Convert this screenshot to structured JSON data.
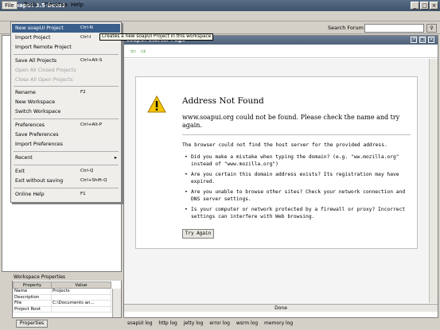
{
  "window": {
    "title": "soapUI 3.5-beta1"
  },
  "menubar": [
    {
      "label": "File"
    },
    {
      "label": "Tools"
    },
    {
      "label": "Desktop"
    },
    {
      "label": "Help"
    }
  ],
  "search": {
    "label": "Search Forum"
  },
  "file_menu": [
    {
      "label": "New soapUI Project",
      "shortcut": "Ctrl-N",
      "selected": true
    },
    {
      "label": "Import Project",
      "shortcut": "Ctrl-I"
    },
    {
      "label": "Import Remote Project",
      "shortcut": ""
    },
    {
      "sep": true
    },
    {
      "label": "Save All Projects",
      "shortcut": "Ctrl+Alt-S"
    },
    {
      "label": "Open All Closed Projects",
      "shortcut": "",
      "disabled": true
    },
    {
      "label": "Close All Open Projects",
      "shortcut": "",
      "disabled": true
    },
    {
      "sep": true
    },
    {
      "label": "Rename",
      "shortcut": "F2"
    },
    {
      "label": "New Workspace",
      "shortcut": ""
    },
    {
      "label": "Switch Workspace",
      "shortcut": ""
    },
    {
      "sep": true
    },
    {
      "label": "Preferences",
      "shortcut": "Ctrl+Alt-P"
    },
    {
      "label": "Save Preferences",
      "shortcut": ""
    },
    {
      "label": "Import Preferences",
      "shortcut": ""
    },
    {
      "sep": true
    },
    {
      "label": "Recent",
      "shortcut": "",
      "submenu": true
    },
    {
      "sep": true
    },
    {
      "label": "Exit",
      "shortcut": "Ctrl-Q"
    },
    {
      "label": "Exit without saving",
      "shortcut": "Ctrl+Shift-Q"
    },
    {
      "sep": true
    },
    {
      "label": "Online Help",
      "shortcut": "F1"
    }
  ],
  "tooltip": "Creates a new soapUI Project in this workspace",
  "starter": {
    "tab_title": "soapUI Starter Page"
  },
  "error_page": {
    "title": "Address Not Found",
    "message": "www.soapui.org could not be found. Please check the name and try again.",
    "description": "The browser could not find the host server for the provided address.",
    "bullets": [
      "Did you make a mistake when typing the domain? (e.g. \"ww.mozilla.org\" instead of \"www.mozilla.org\")",
      "Are you certain this domain address exists? Its registration may have expired.",
      "Are you unable to browse other sites? Check your network connection and DNS server settings.",
      "Is your computer or network protected by a firewall or proxy? Incorrect settings can interfere with Web browsing."
    ],
    "try_again": "Try Again"
  },
  "status": "Done",
  "workspace_props": {
    "title": "Workspace Properties",
    "headers": [
      "Property",
      "Value"
    ],
    "rows": [
      [
        "Name",
        "Projects"
      ],
      [
        "Description",
        ""
      ],
      [
        "File",
        "C:\\Documents an..."
      ],
      [
        "Project Root",
        ""
      ]
    ],
    "tab": "Properties"
  },
  "log_tabs": [
    "soapUI log",
    "http log",
    "jetty log",
    "error log",
    "wsrm log",
    "memory log"
  ]
}
